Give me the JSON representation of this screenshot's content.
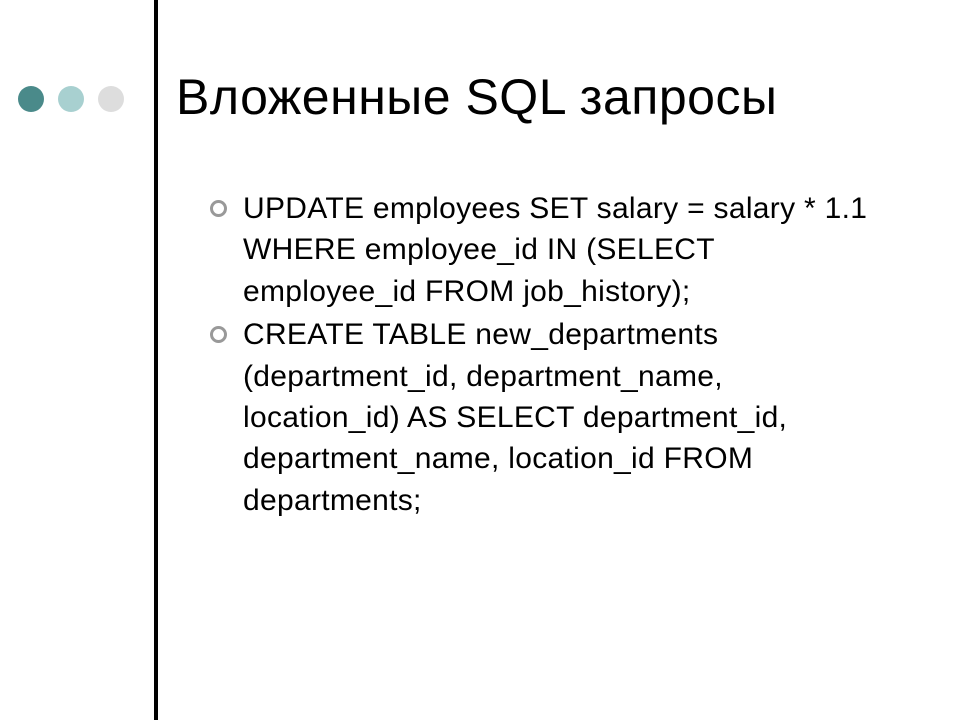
{
  "title": "Вложенные SQL запросы",
  "bullets": [
    "UPDATE employees SET salary = salary * 1.1 WHERE employee_id IN (SELECT employee_id FROM job_history);",
    "CREATE TABLE new_departments (department_id, department_name, location_id) AS SELECT department_id, department_name, location_id FROM departments;"
  ]
}
